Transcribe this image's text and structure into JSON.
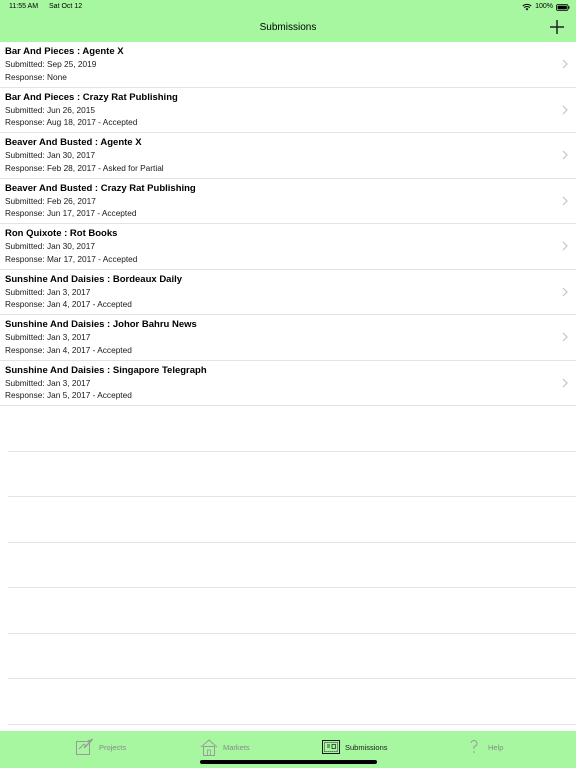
{
  "status_bar": {
    "time": "11:55 AM",
    "date": "Sat Oct 12",
    "battery": "100%"
  },
  "nav": {
    "title": "Submissions",
    "add_icon": "plus-icon"
  },
  "submissions": [
    {
      "title": "Bar And Pieces : Agente X",
      "submitted": "Submitted: Sep 25, 2019",
      "response": "Response: None"
    },
    {
      "title": "Bar And Pieces : Crazy Rat Publishing",
      "submitted": "Submitted: Jun 26, 2015",
      "response": "Response: Aug 18, 2017 - Accepted"
    },
    {
      "title": "Beaver And Busted : Agente X",
      "submitted": "Submitted: Jan 30, 2017",
      "response": "Response: Feb 28, 2017 - Asked for Partial"
    },
    {
      "title": "Beaver And Busted : Crazy Rat Publishing",
      "submitted": "Submitted: Feb 26, 2017",
      "response": "Response: Jun 17, 2017 - Accepted"
    },
    {
      "title": "Ron Quixote : Rot Books",
      "submitted": "Submitted: Jan 30, 2017",
      "response": "Response: Mar 17, 2017 - Accepted"
    },
    {
      "title": "Sunshine And Daisies : Bordeaux Daily",
      "submitted": "Submitted: Jan 3, 2017",
      "response": "Response: Jan 4, 2017 - Accepted"
    },
    {
      "title": "Sunshine And Daisies : Johor Bahru News",
      "submitted": "Submitted: Jan 3, 2017",
      "response": "Response: Jan 4, 2017 - Accepted"
    },
    {
      "title": "Sunshine And Daisies : Singapore Telegraph",
      "submitted": "Submitted: Jan 3, 2017",
      "response": "Response: Jan 5, 2017 - Accepted"
    }
  ],
  "tabs": [
    {
      "label": "Projects",
      "icon": "projects-icon",
      "active": false
    },
    {
      "label": "Markets",
      "icon": "house-icon",
      "active": false
    },
    {
      "label": "Submissions",
      "icon": "submissions-icon",
      "active": true
    },
    {
      "label": "Help",
      "icon": "question-icon",
      "active": false
    }
  ],
  "colors": {
    "bar_background": "#a6f7a0",
    "separator": "#e3e3e3",
    "inactive_tab": "#8a8a8a"
  }
}
